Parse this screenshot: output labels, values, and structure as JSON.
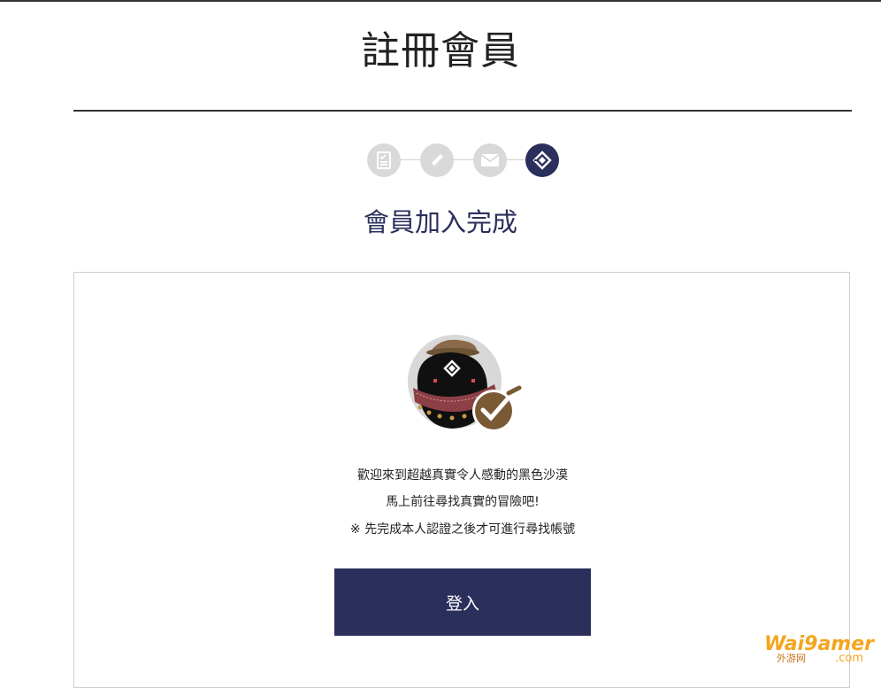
{
  "page": {
    "title": "註冊會員"
  },
  "steps": {
    "items": [
      {
        "icon": "checklist-icon",
        "state": "done"
      },
      {
        "icon": "pencil-icon",
        "state": "done"
      },
      {
        "icon": "envelope-icon",
        "state": "done"
      },
      {
        "icon": "diamond-logo-icon",
        "state": "active"
      }
    ],
    "active_index": 3
  },
  "completion": {
    "heading": "會員加入完成",
    "message_line1": "歡迎來到超越真實令人感動的黑色沙漠",
    "message_line2": "馬上前往尋找真實的冒險吧!",
    "notice": "※ 先完成本人認證之後才可進行尋找帳號",
    "login_label": "登入"
  },
  "watermark": {
    "brand": "Wai9amer",
    "sub": "外游网",
    "domain": ".com"
  },
  "colors": {
    "accent": "#2b2f5b",
    "step_inactive": "#d9d9d9",
    "checkmark_badge": "#7a5a35"
  }
}
